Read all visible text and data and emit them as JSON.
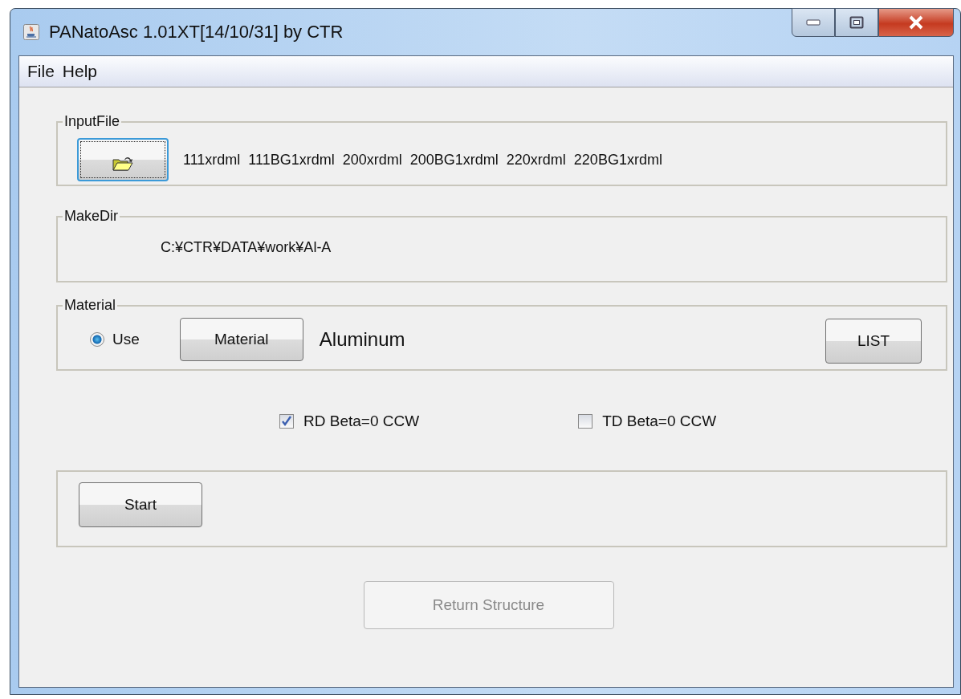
{
  "window": {
    "title": "PANatoAsc 1.01XT[14/10/31] by CTR"
  },
  "menu": [
    {
      "label": "File"
    },
    {
      "label": "Help"
    }
  ],
  "input_file": {
    "legend": "InputFile",
    "files": "111xrdml  111BG1xrdml  200xrdml  200BG1xrdml  220xrdml  220BG1xrdml"
  },
  "make_dir": {
    "legend": "MakeDir",
    "path": "C:¥CTR¥DATA¥work¥Al-A"
  },
  "material": {
    "legend": "Material",
    "use_radio": {
      "label": "Use",
      "selected": true
    },
    "button": "Material",
    "value": "Aluminum",
    "list_button": "LIST"
  },
  "options": [
    {
      "label": "RD Beta=0 CCW",
      "checked": true
    },
    {
      "label": "TD Beta=0 CCW",
      "checked": false
    }
  ],
  "start_button": "Start",
  "return_button": {
    "label": "Return Structure",
    "disabled": true
  }
}
